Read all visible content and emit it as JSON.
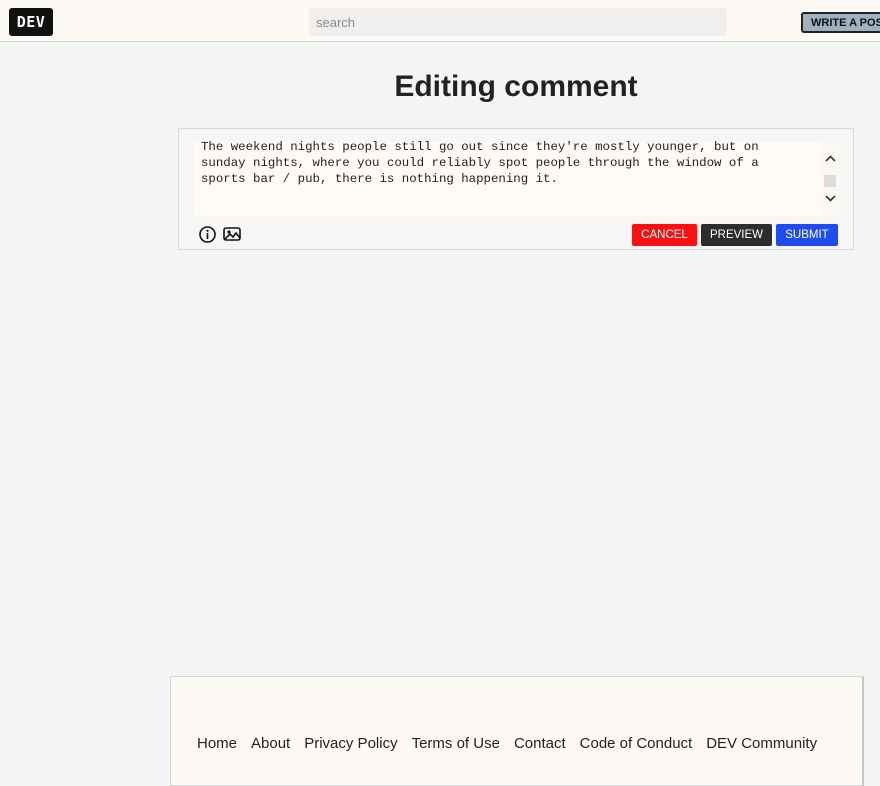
{
  "header": {
    "logo_text": "DEV",
    "search_placeholder": "search",
    "write_post_label": "WRITE A POST"
  },
  "page": {
    "title": "Editing comment"
  },
  "editor": {
    "comment_text": "The weekend nights people still go out since they're mostly younger, but on sunday nights, where you could reliably spot people through the window of a sports bar / pub, there is nothing happening it.",
    "icons": [
      "info-icon",
      "image-icon"
    ],
    "cancel_label": "CANCEL",
    "preview_label": "PREVIEW",
    "submit_label": "SUBMIT"
  },
  "footer": {
    "links": [
      "Home",
      "About",
      "Privacy Policy",
      "Terms of Use",
      "Contact",
      "Code of Conduct",
      "DEV Community"
    ]
  },
  "colors": {
    "cancel": "#ff1010",
    "preview": "#2d2d2d",
    "submit": "#1f4cf0",
    "background": "#f4f5f7"
  }
}
